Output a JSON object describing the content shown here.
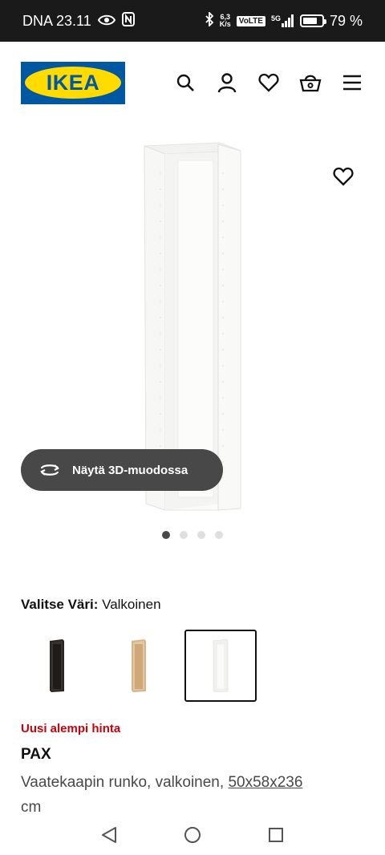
{
  "status_bar": {
    "carrier_time": "DNA 23.11",
    "net_speed_value": "6,3",
    "net_speed_unit": "K/s",
    "volte": "VoLTE",
    "network": "5G",
    "battery": "79 %",
    "battery_level": 0.79
  },
  "header": {
    "logo_text": "IKEA",
    "icons": [
      "search-icon",
      "account-icon",
      "heart-icon",
      "basket-icon",
      "menu-icon"
    ]
  },
  "gallery": {
    "view_3d_label": "Näytä 3D-muodossa",
    "dots_count": 4,
    "active_dot": 0
  },
  "color_select": {
    "label": "Valitse Väri:",
    "value": "Valkoinen",
    "swatches": [
      {
        "name": "black-brown",
        "color": "#2b2622",
        "selected": false
      },
      {
        "name": "oak",
        "color": "#d7b48c",
        "selected": false
      },
      {
        "name": "white",
        "color": "#f4f4f2",
        "selected": true
      }
    ]
  },
  "product": {
    "promo": "Uusi alempi hinta",
    "name": "PAX",
    "description": "Vaatekaapin runko, valkoinen,",
    "measurement": "50x58x236",
    "unit": "cm"
  },
  "colors": {
    "brand_blue": "#0058a3",
    "brand_yellow": "#ffdb00",
    "promo_red": "#cc0008"
  }
}
